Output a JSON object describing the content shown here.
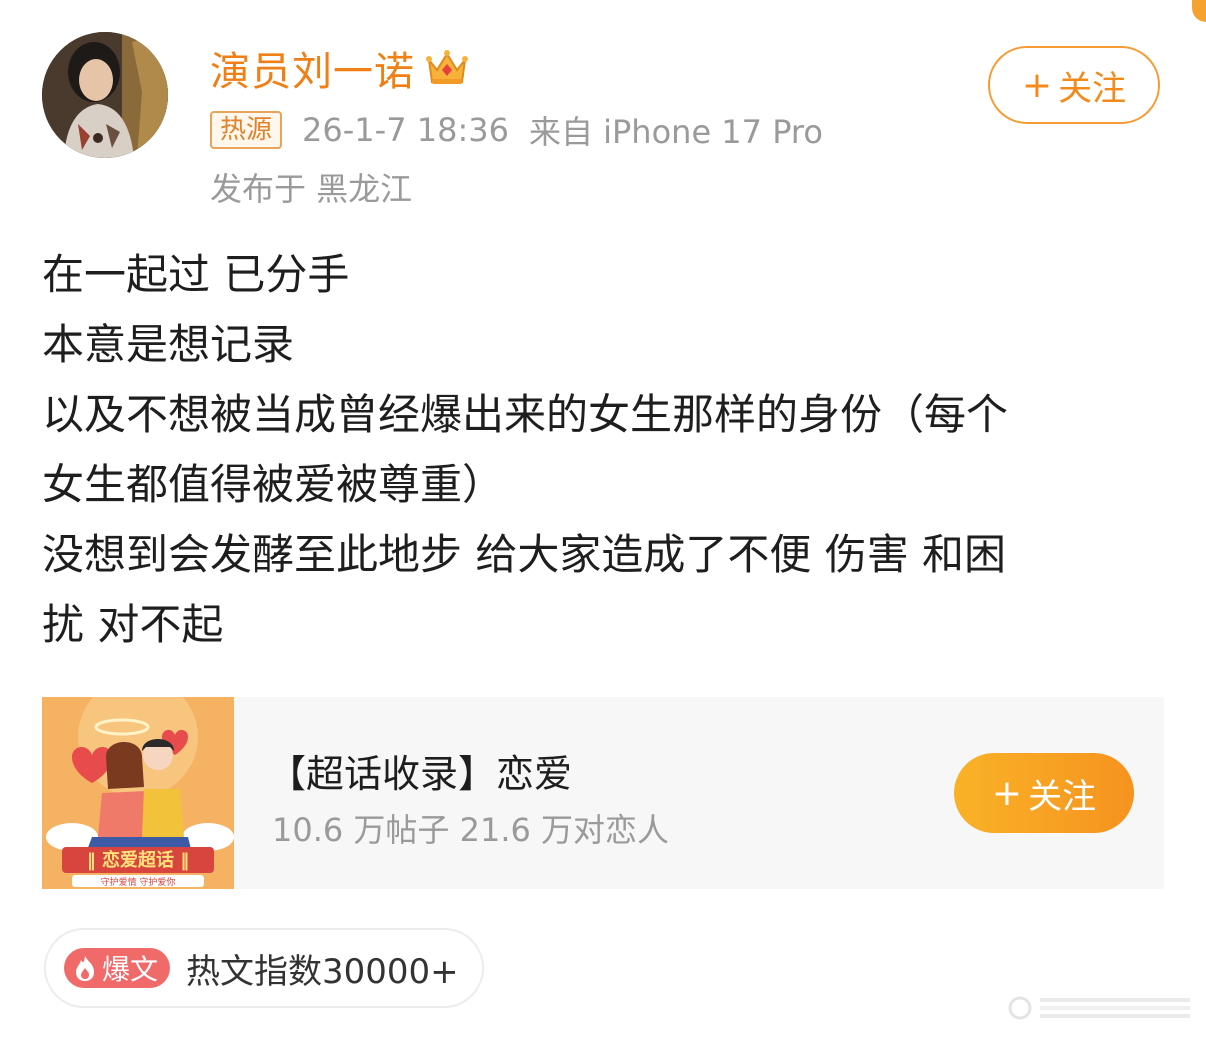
{
  "author": {
    "name": "演员刘一诺",
    "verified_icon": "crown-icon"
  },
  "follow_button": {
    "plus": "+",
    "label": "关注"
  },
  "meta": {
    "badge": "热源",
    "time": "26-1-7 18:36",
    "source": "来自 iPhone 17 Pro",
    "location": "发布于 黑龙江"
  },
  "post": {
    "lines": [
      "在一起过 已分手",
      "本意是想记录",
      "以及不想被当成曾经爆出来的女生那样的身份（每个",
      "女生都值得被爱被尊重）",
      "没想到会发酵至此地步 给大家造成了不便 伤害 和困",
      "扰 对不起"
    ]
  },
  "topic_card": {
    "title": "【超话收录】恋爱",
    "stats": "10.6 万帖子 21.6 万对恋人",
    "cover_text": "恋爱超话",
    "cover_subtext": "守护爱情 守护爱你",
    "follow_plus": "+",
    "follow_label": "关注"
  },
  "hot_index": {
    "badge": "爆文",
    "text": "热文指数30000+"
  },
  "colors": {
    "accent": "#f07f15",
    "button_gradient_start": "#f9b227",
    "button_gradient_end": "#f6931f",
    "meta_gray": "#9a9a9a",
    "bao_red": "#f06a6a"
  }
}
